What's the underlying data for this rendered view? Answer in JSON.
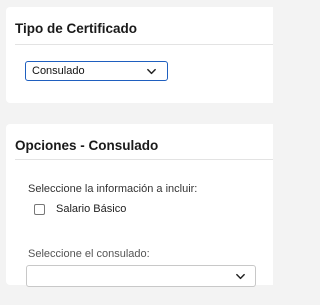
{
  "certificate_type": {
    "title": "Tipo de Certificado",
    "selected": "Consulado"
  },
  "options": {
    "title": "Opciones - Consulado",
    "info_label": "Seleccione la información a incluir:",
    "checkbox_label": "Salario Básico",
    "checkbox_checked": false,
    "consulado_label": "Seleccione el consulado:",
    "consulado_value": ""
  },
  "icons": {
    "dropdown": "chevron-down-icon",
    "checkbox": "checkbox-icon"
  },
  "colors": {
    "accent": "#1f5fbf",
    "background": "#f3f3f3",
    "card": "#ffffff"
  }
}
